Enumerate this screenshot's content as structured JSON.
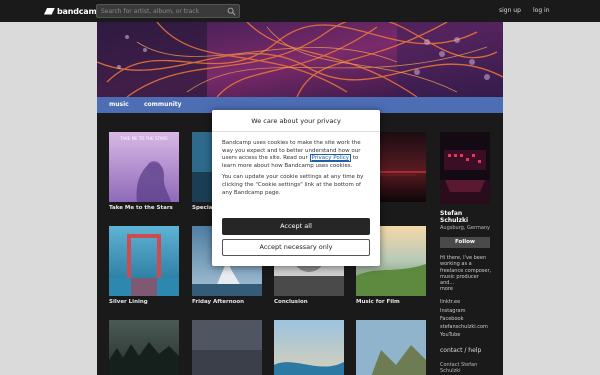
{
  "header": {
    "logo_text": "bandcamp",
    "search_placeholder": "Search for artist, album, or track",
    "signup": "sign up",
    "login": "log in"
  },
  "nav": {
    "music": "music",
    "community": "community"
  },
  "discography": [
    {
      "title": "Take Me to the Stars",
      "art_text": "TAKE ME TO THE STARS"
    },
    {
      "title": "Special"
    },
    {
      "title": ""
    },
    {
      "title": ""
    },
    {
      "title": "Silver Lining"
    },
    {
      "title": "Friday Afternoon"
    },
    {
      "title": "Conclusion"
    },
    {
      "title": "Music for Film"
    },
    {
      "title": ""
    },
    {
      "title": ""
    },
    {
      "title": ""
    },
    {
      "title": ""
    }
  ],
  "artist": {
    "name": "Stefan Schulzki",
    "location": "Augsburg, Germany",
    "follow_label": "Follow",
    "bio": "Hi there, I've been working as a freelance composer, music producer and...",
    "more": "more",
    "links": [
      "linktr.ee",
      "Instagram",
      "Facebook",
      "stefanschulzki.com",
      "YouTube"
    ],
    "help_link": "contact / help",
    "contact": "Contact Stefan Schulzki"
  },
  "cookie_dialog": {
    "title": "We care about your privacy",
    "para1_before": "Bandcamp uses cookies to make the site work the way you expect and to better understand how our users access the site. Read our ",
    "privacy_link": "Privacy Policy",
    "para1_after": " to learn more about how Bandcamp uses cookies.",
    "para2": "You can update your cookie settings at any time by clicking the \"Cookie settings\" link at the bottom of any Bandcamp page.",
    "accept_all": "Accept all",
    "accept_necessary": "Accept necessary only"
  }
}
